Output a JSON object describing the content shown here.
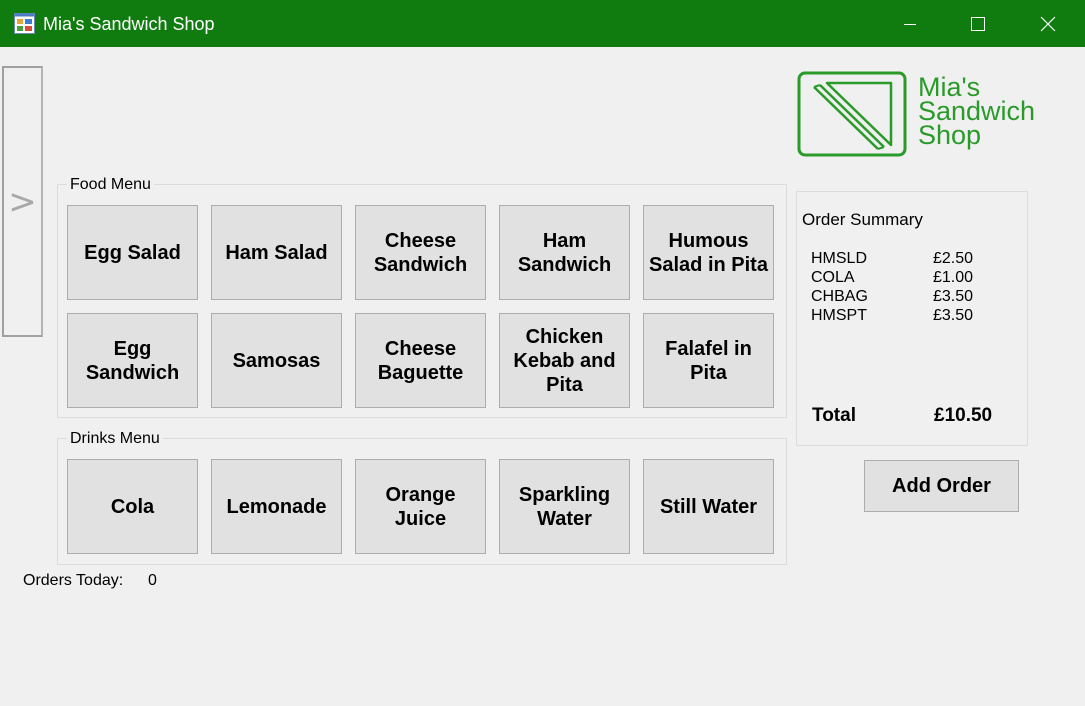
{
  "window": {
    "title": "Mia's Sandwich Shop",
    "title_bar_color": "#107c10",
    "icons": [
      "app-icon",
      "minimize-icon",
      "maximize-icon",
      "close-icon"
    ]
  },
  "side_toggle": {
    "label": ">"
  },
  "logo": {
    "text_lines": [
      "Mia's",
      "Sandwich",
      "Shop"
    ],
    "color": "#2a9a2a",
    "icon": "sandwich-logo-icon"
  },
  "food_menu": {
    "label": "Food Menu",
    "items": [
      {
        "label": "Egg Salad"
      },
      {
        "label": "Ham Salad"
      },
      {
        "label": "Cheese Sandwich"
      },
      {
        "label": "Ham Sandwich"
      },
      {
        "label": "Humous Salad in Pita"
      },
      {
        "label": "Egg Sandwich"
      },
      {
        "label": "Samosas"
      },
      {
        "label": "Cheese Baguette"
      },
      {
        "label": "Chicken Kebab and Pita"
      },
      {
        "label": "Falafel in Pita"
      }
    ]
  },
  "drinks_menu": {
    "label": "Drinks Menu",
    "items": [
      {
        "label": "Cola"
      },
      {
        "label": "Lemonade"
      },
      {
        "label": "Orange Juice"
      },
      {
        "label": "Sparkling Water"
      },
      {
        "label": "Still Water"
      }
    ]
  },
  "orders_today": {
    "label": "Orders Today:",
    "value": "0"
  },
  "order_summary": {
    "title": "Order Summary",
    "items": [
      {
        "code": "HMSLD",
        "price": "£2.50"
      },
      {
        "code": "COLA",
        "price": "£1.00"
      },
      {
        "code": "CHBAG",
        "price": "£3.50"
      },
      {
        "code": "HMSPT",
        "price": "£3.50"
      }
    ],
    "total_label": "Total",
    "total_value": "£10.50"
  },
  "add_order": {
    "label": "Add Order"
  }
}
